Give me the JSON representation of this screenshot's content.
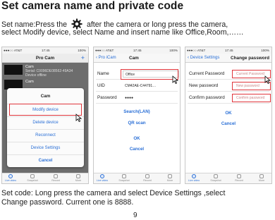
{
  "title": "Set camera name and private code",
  "intro": {
    "part1": "Set name:Press the",
    "part2": "after the camera or long press the camera,",
    "line2": "select Modify device, select Name and insert name like Office,Room,……"
  },
  "status_bar": {
    "carrier": "●●●○○ AT&T",
    "time": "17:45",
    "battery": "100%"
  },
  "tabs": [
    "Live video",
    "Snapshot",
    "Record",
    "More"
  ],
  "phone1": {
    "nav_title": "Pro Cam",
    "list": [
      {
        "name": "Cam",
        "detail": "Serial: C0096DE08562-49A34",
        "status": "Device offline"
      },
      {
        "name": "Cam",
        "detail": "",
        "status": ""
      }
    ],
    "sheet": {
      "title": "Cam",
      "items": [
        "Modify device",
        "Delete device",
        "Reconnect",
        "Device Settings",
        "Cancel"
      ]
    }
  },
  "phone2": {
    "back": "Pro iCam",
    "nav_title": "Cam",
    "fields": [
      {
        "label": "Name",
        "value": "Office"
      },
      {
        "label": "UID",
        "value": "CM42AE-C44791…"
      },
      {
        "label": "Password",
        "value": "●●●●"
      }
    ],
    "links": [
      "Search(LAN)",
      "QR scan",
      "OK",
      "Cancel"
    ]
  },
  "phone3": {
    "back": "Device Settings",
    "nav_title": "Change password",
    "fields": [
      {
        "label": "Current Password",
        "placeholder": "Current Password"
      },
      {
        "label": "New password",
        "placeholder": "New password"
      },
      {
        "label": "Confirm password",
        "placeholder": "Confirm password"
      }
    ],
    "links": [
      "OK",
      "Cancel"
    ]
  },
  "outro": {
    "line1": "Set code: Long press the camera and select Device Settings ,select",
    "line2": "Change password. Current one is 8888."
  },
  "page_number": "9",
  "colors": {
    "highlight": "#e0353b",
    "link": "#2a6fd6"
  },
  "icons": [
    "gear-icon",
    "cursor-icon",
    "plus-icon",
    "back-chevron-icon"
  ]
}
